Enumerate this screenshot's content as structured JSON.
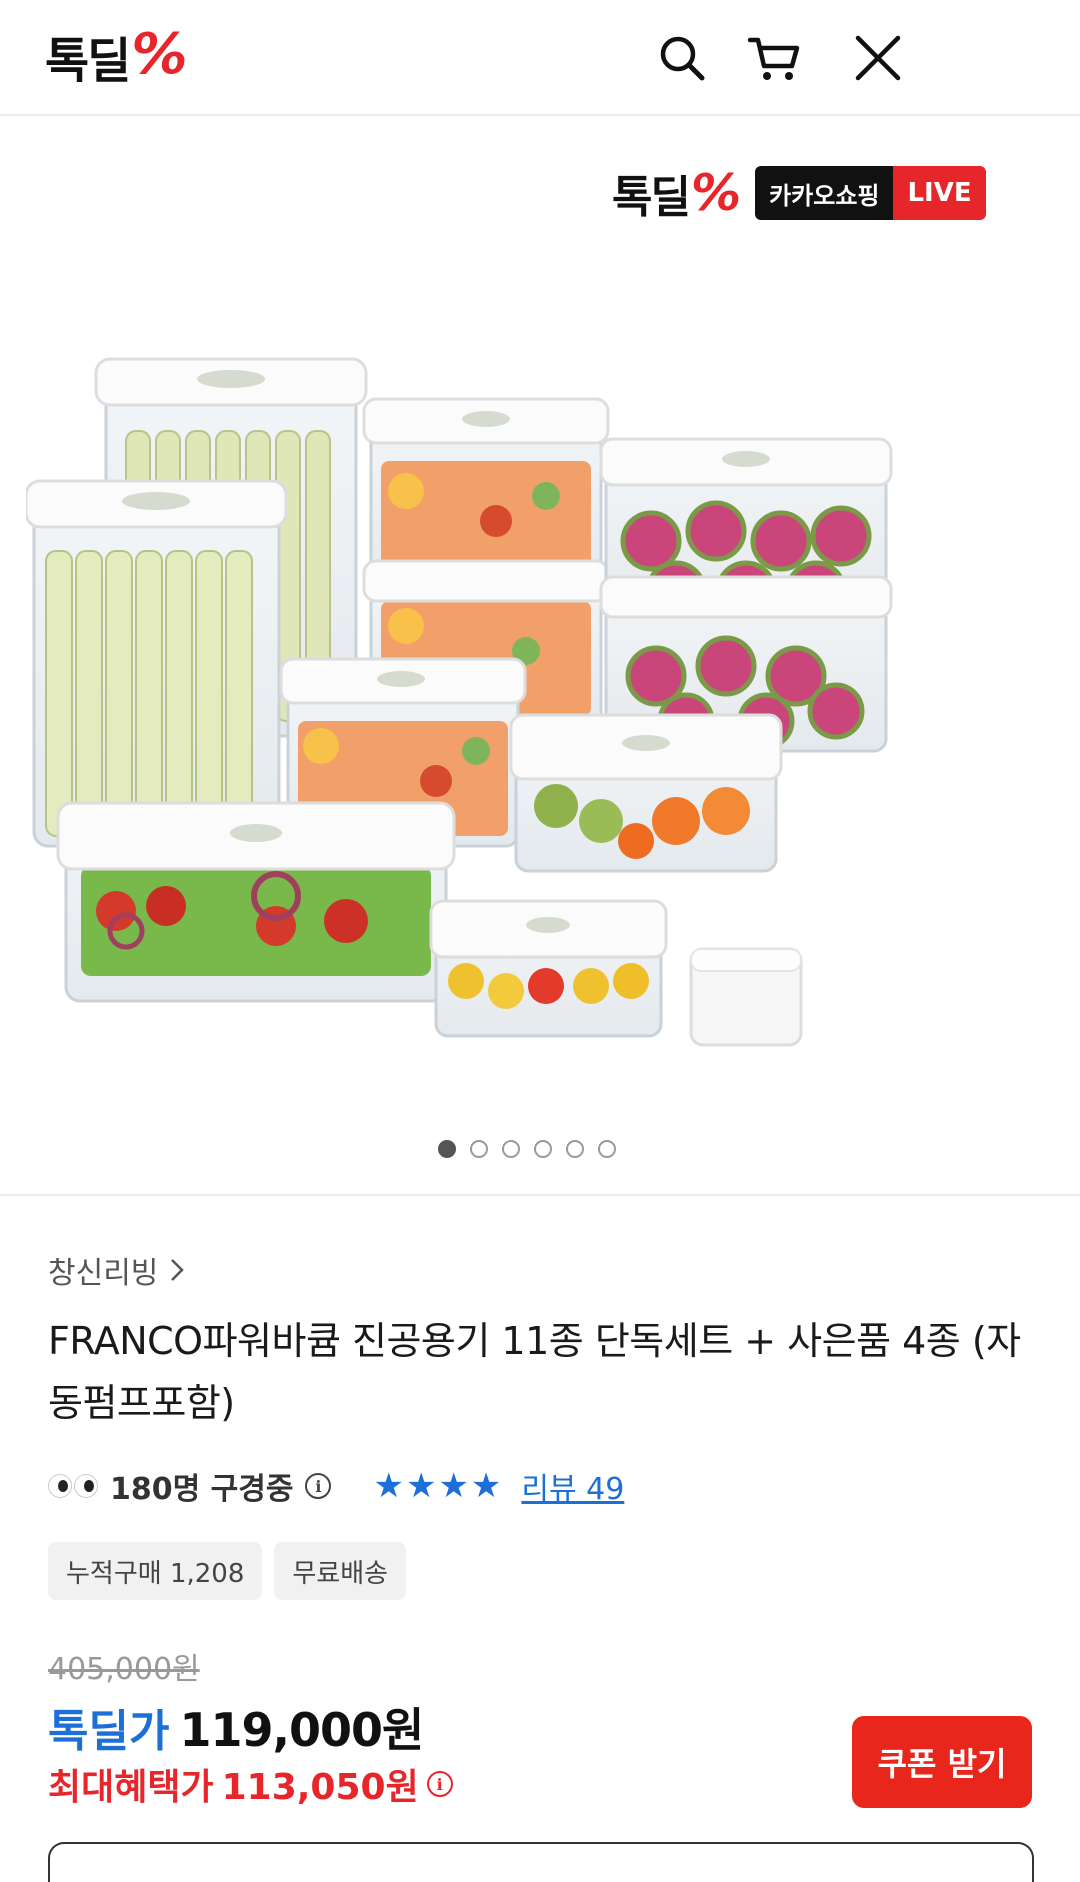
{
  "header": {
    "logo_text": "톡딜",
    "logo_mark": "%",
    "icons": [
      "search-icon",
      "cart-icon",
      "close-icon"
    ]
  },
  "gallery": {
    "brand_logo_text": "톡딜",
    "brand_logo_mark": "%",
    "kakao_label": "카카오쇼핑",
    "live_label": "LIVE",
    "slide_count": 6,
    "active_slide": 1
  },
  "product": {
    "seller": "창신리빙",
    "title": "FRANCO파워바큠 진공용기 11종 단독세트 + 사은품 4종 (자동펌프포함)",
    "viewers_text": "180명 구경중",
    "rating": 4,
    "review_text": "리뷰 49",
    "chips": [
      "누적구매 1,208",
      "무료배송"
    ],
    "original_price": "405,000원",
    "deal_label": "톡딜가",
    "deal_price": "119,000원",
    "max_label": "최대혜택가",
    "max_price": "113,050원",
    "coupon_label": "쿠폰 받기"
  },
  "colors": {
    "brand_red": "#e6262a",
    "link_blue": "#1b6fd7",
    "coupon_red": "#e8261c"
  }
}
